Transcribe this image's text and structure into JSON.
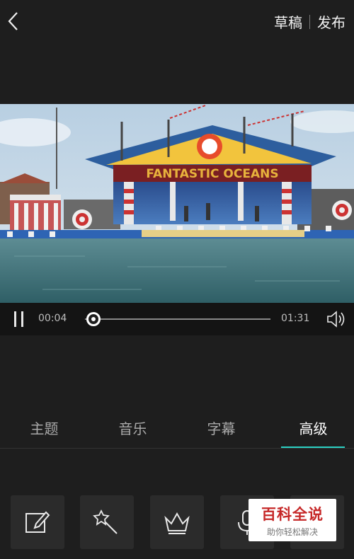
{
  "header": {
    "back_icon": "chevron-left-icon",
    "draft_label": "草稿",
    "publish_label": "发布"
  },
  "video": {
    "stage_sign": "FANTASTIC OCEANS"
  },
  "player": {
    "current_time": "00:04",
    "total_time": "01:31",
    "progress": 0.044,
    "state": "playing"
  },
  "tabs": {
    "items": [
      {
        "label": "主题"
      },
      {
        "label": "音乐"
      },
      {
        "label": "字幕"
      },
      {
        "label": "高级",
        "active": true
      }
    ],
    "accent_color": "#2bd1c4"
  },
  "tools": [
    {
      "icon": "edit-icon"
    },
    {
      "icon": "magic-wand-icon"
    },
    {
      "icon": "crown-icon"
    },
    {
      "icon": "microphone-icon"
    },
    {
      "icon": "more-icon"
    }
  ],
  "watermark": {
    "title": "百科全说",
    "subtitle": "助你轻松解决"
  }
}
